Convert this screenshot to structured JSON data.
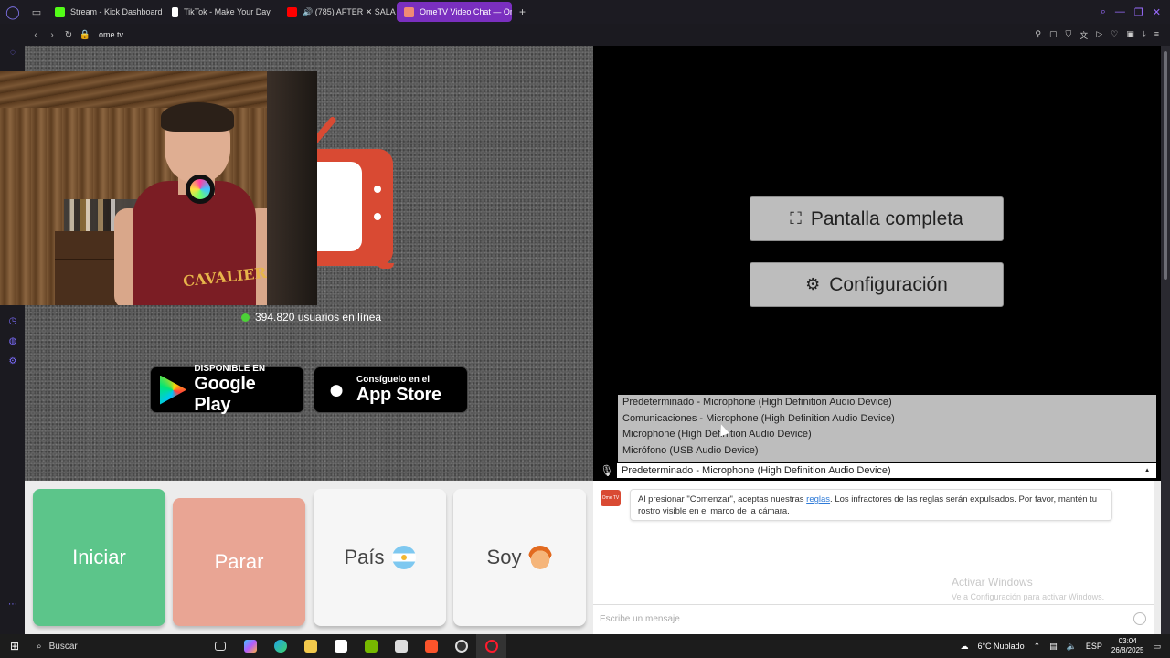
{
  "browser": {
    "tabs": [
      {
        "label": "Stream - Kick Dashboard",
        "color": "#53fc18"
      },
      {
        "label": "TikTok - Make Your Day",
        "color": "#ffffff"
      },
      {
        "label": "🔊 (785) AFTER ✕ SALA",
        "color": "#ff0000"
      },
      {
        "label": "OmeTV Video Chat — Om",
        "color": "#d94a33"
      }
    ],
    "new_tab": "+",
    "url": "ome.tv"
  },
  "partner": {
    "logo_text": "e",
    "online_count": "394.820 usuarios en línea",
    "google_play": {
      "small": "DISPONIBLE EN",
      "big": "Google Play"
    },
    "app_store": {
      "small": "Consíguelo en el",
      "big": "App Store"
    }
  },
  "self_cam": {
    "jersey": "CAVALIERS"
  },
  "controls": {
    "fullscreen": "Pantalla completa",
    "settings": "Configuración"
  },
  "microphone": {
    "options": [
      "Predeterminado - Microphone (High Definition Audio Device)",
      "Comunicaciones - Microphone (High Definition Audio Device)",
      "Microphone (High Definition Audio Device)",
      "Micrófono (USB Audio Device)"
    ],
    "selected": "Predeterminado - Microphone (High Definition Audio Device)"
  },
  "buttons": {
    "start": "Iniciar",
    "stop": "Parar",
    "country": "País",
    "gender": "Soy"
  },
  "chat": {
    "logo": "Ome TV",
    "message_before": "Al presionar \"Comenzar\", aceptas nuestras ",
    "message_link": "reglas",
    "message_after": ". Los infractores de las reglas serán expulsados. Por favor, mantén tu rostro visible en el marco de la cámara.",
    "input_placeholder": "Escribe un mensaje"
  },
  "watermark": {
    "line1": "Activar Windows",
    "line2": "Ve a Configuración para activar Windows."
  },
  "taskbar": {
    "search": "Buscar",
    "weather": "6°C  Nublado",
    "lang": "ESP",
    "time": "03:04",
    "date": "26/8/2025"
  }
}
